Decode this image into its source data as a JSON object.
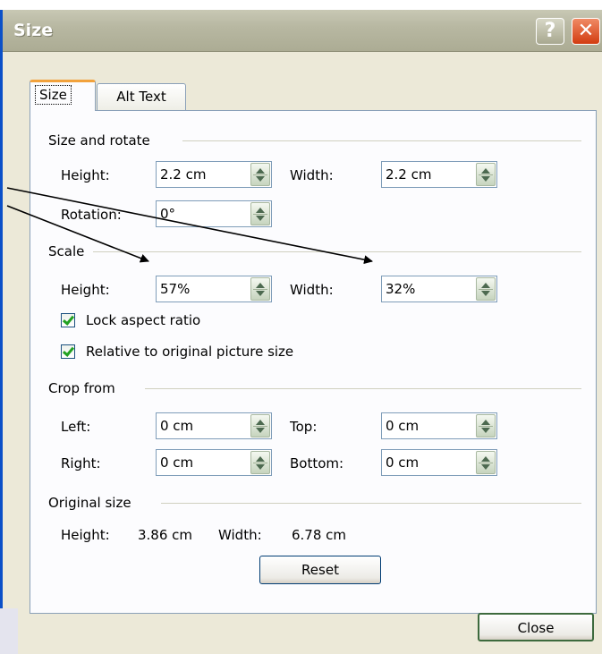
{
  "window": {
    "title": "Size",
    "help_glyph": "?",
    "close_glyph": "✕"
  },
  "tabs": [
    {
      "label": "Size",
      "active": true
    },
    {
      "label": "Alt Text",
      "active": false
    }
  ],
  "size_rotate": {
    "group_label": "Size and rotate",
    "height_label": "Height:",
    "height_value": "2.2 cm",
    "width_label": "Width:",
    "width_value": "2.2 cm",
    "rotation_label": "Rotation:",
    "rotation_value": "0°"
  },
  "scale": {
    "group_label": "Scale",
    "height_label": "Height:",
    "height_value": "57%",
    "width_label": "Width:",
    "width_value": "32%",
    "lock_aspect_label": "Lock aspect ratio",
    "lock_aspect_checked": true,
    "relative_label": "Relative to original picture size",
    "relative_checked": true
  },
  "crop": {
    "group_label": "Crop from",
    "left_label": "Left:",
    "left_value": "0 cm",
    "top_label": "Top:",
    "top_value": "0 cm",
    "right_label": "Right:",
    "right_value": "0 cm",
    "bottom_label": "Bottom:",
    "bottom_value": "0 cm"
  },
  "original": {
    "group_label": "Original size",
    "height_label": "Height:",
    "height_value": "3.86 cm",
    "width_label": "Width:",
    "width_value": "6.78 cm",
    "reset_label": "Reset"
  },
  "footer": {
    "close_label": "Close"
  },
  "colors": {
    "window_border": "#0b50c8",
    "dialog_bg": "#ece9d8",
    "active_tab_accent": "#f2a23c",
    "checkmark": "#21a121",
    "close_button_red": "#d23c10"
  }
}
